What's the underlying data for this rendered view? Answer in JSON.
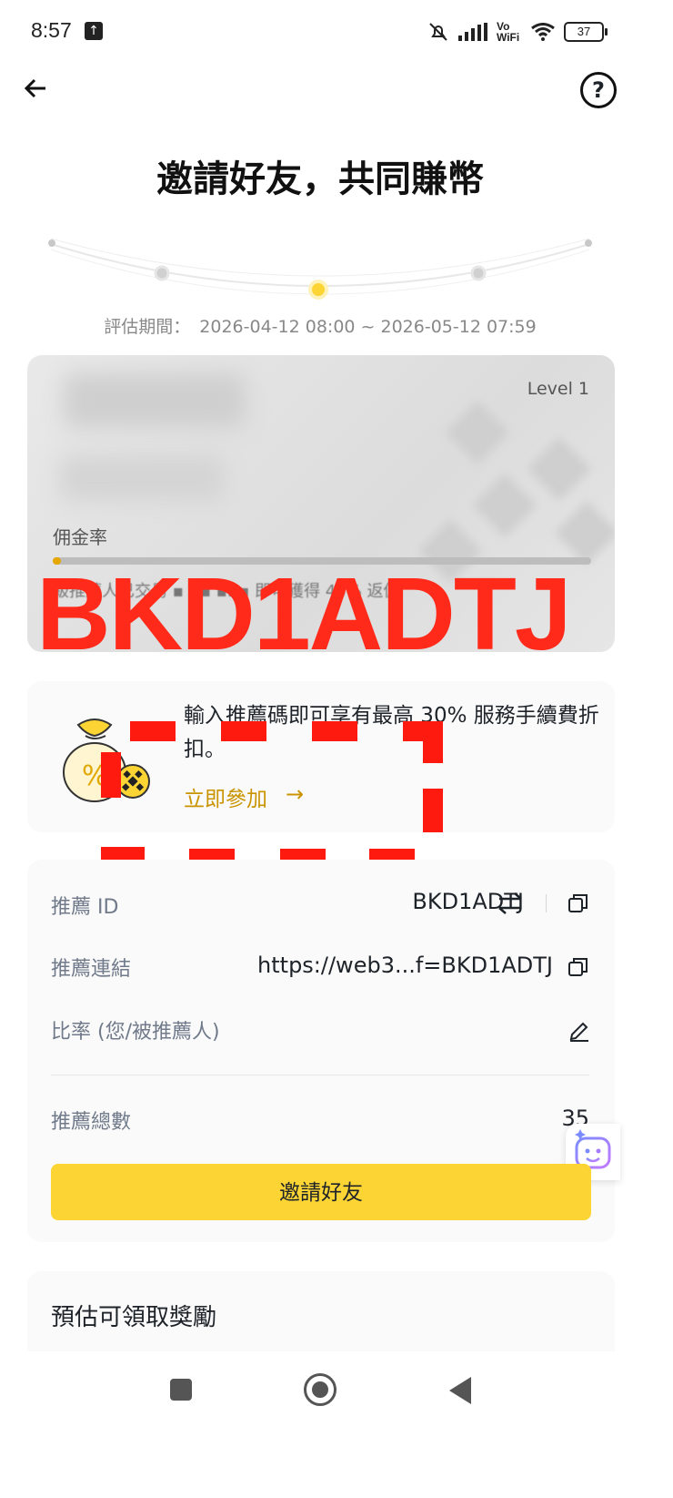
{
  "status_bar": {
    "time": "8:57",
    "vowifi": "Vo WiFi",
    "battery": "37"
  },
  "header": {
    "title": "邀請好友，共同賺幣",
    "help_icon": "?"
  },
  "period": {
    "label": "評估期間：",
    "value": "2026-04-12 08:00 ~ 2026-05-12 07:59"
  },
  "level_card": {
    "level": "Level 1",
    "commission_label": "佣金率",
    "progress_fraction": 0.015,
    "description": "級推薦人已交易 ▪ ▪▪ ▪▪▪ 即可獲得 40% 返佣"
  },
  "overlay_code": "BKD1ADTJ",
  "promo": {
    "text": "輸入推薦碼即可享有最高 30% 服務手續費折扣。",
    "link_label": "立即參加"
  },
  "referral": {
    "id_label": "推薦 ID",
    "id_value": "BKD1ADTJ",
    "link_label": "推薦連結",
    "link_value": "https://web3...f=BKD1ADTJ",
    "ratio_label": "比率 (您/被推薦人)",
    "total_label": "推薦總數",
    "total_value": "35",
    "invite_button": "邀請好友"
  },
  "rewards": {
    "title": "預估可領取獎勵"
  },
  "colors": {
    "accent": "#fcd535",
    "link_gold": "#c99400",
    "overlay_red": "#ff2a1a"
  }
}
